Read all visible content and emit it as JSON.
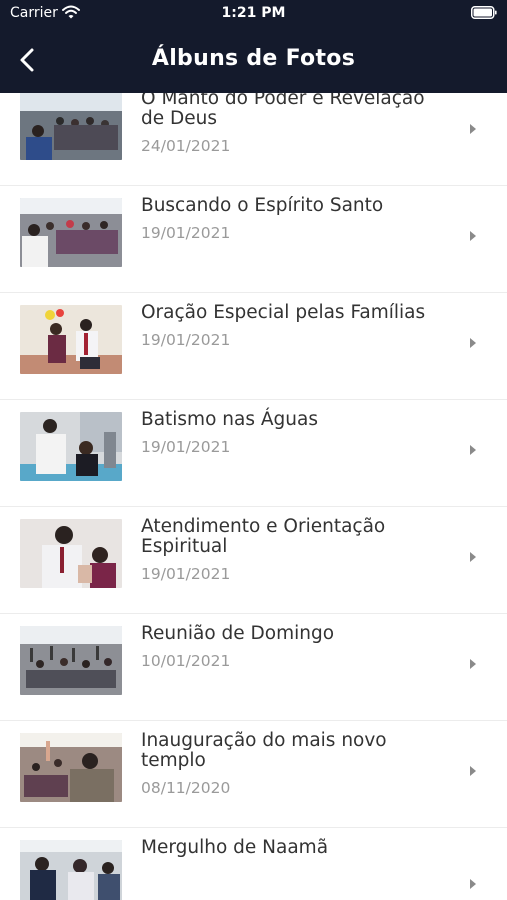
{
  "status": {
    "carrier": "Carrier",
    "time": "1:21 PM"
  },
  "nav": {
    "back_icon": "chevron-left-icon",
    "title": "Álbuns de Fotos"
  },
  "albums": [
    {
      "title": "O Manto do Poder e Revelação de Deus",
      "date": "24/01/2021"
    },
    {
      "title": "Buscando o Espírito Santo",
      "date": "19/01/2021"
    },
    {
      "title": "Oração Especial pelas Famílias",
      "date": "19/01/2021"
    },
    {
      "title": "Batismo nas Águas",
      "date": "19/01/2021"
    },
    {
      "title": "Atendimento e Orientação Espiritual",
      "date": "19/01/2021"
    },
    {
      "title": "Reunião de Domingo",
      "date": "10/01/2021"
    },
    {
      "title": " Inauguração do mais novo templo",
      "date": "08/11/2020"
    },
    {
      "title": "Mergulho de Naamã",
      "date": ""
    }
  ],
  "colors": {
    "header_bg": "#141a2c",
    "title_text": "#333333",
    "date_text": "#9a9a9a",
    "chevron": "#8a8a8a"
  }
}
